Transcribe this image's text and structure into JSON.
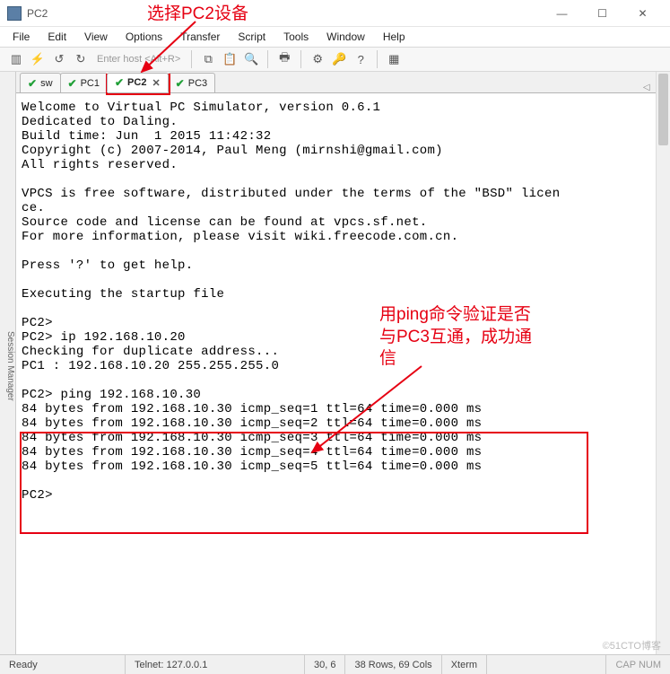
{
  "window": {
    "title": "PC2"
  },
  "menu": {
    "file": "File",
    "edit": "Edit",
    "view": "View",
    "options": "Options",
    "transfer": "Transfer",
    "script": "Script",
    "tools": "Tools",
    "window": "Window",
    "help": "Help"
  },
  "toolbar": {
    "host_placeholder": "Enter host <Alt+R>"
  },
  "sidepanel": {
    "label": "Session Manager"
  },
  "tabs": {
    "t0": "sw",
    "t1": "PC1",
    "t2": "PC2",
    "t3": "PC3",
    "close": "✕",
    "arrows": "◁ ▷"
  },
  "terminal": {
    "body": "Welcome to Virtual PC Simulator, version 0.6.1\nDedicated to Daling.\nBuild time: Jun  1 2015 11:42:32\nCopyright (c) 2007-2014, Paul Meng (mirnshi@gmail.com)\nAll rights reserved.\n\nVPCS is free software, distributed under the terms of the \"BSD\" licen\nce.\nSource code and license can be found at vpcs.sf.net.\nFor more information, please visit wiki.freecode.com.cn.\n\nPress '?' to get help.\n\nExecuting the startup file\n\nPC2>\nPC2> ip 192.168.10.20\nChecking for duplicate address...\nPC1 : 192.168.10.20 255.255.255.0\n\nPC2> ping 192.168.10.30\n84 bytes from 192.168.10.30 icmp_seq=1 ttl=64 time=0.000 ms\n84 bytes from 192.168.10.30 icmp_seq=2 ttl=64 time=0.000 ms\n84 bytes from 192.168.10.30 icmp_seq=3 ttl=64 time=0.000 ms\n84 bytes from 192.168.10.30 icmp_seq=4 ttl=64 time=0.000 ms\n84 bytes from 192.168.10.30 icmp_seq=5 ttl=64 time=0.000 ms\n\nPC2> "
  },
  "status": {
    "ready": "Ready",
    "telnet": "Telnet: 127.0.0.1",
    "pos": "30,  6",
    "size": "38 Rows, 69 Cols",
    "term": "Xterm",
    "caps": "CAP  NUM"
  },
  "annotations": {
    "a1": "选择PC2设备",
    "a2": "用ping命令验证是否\n与PC3互通，成功通\n信"
  },
  "watermark": {
    "text": "©51CTO博客"
  }
}
